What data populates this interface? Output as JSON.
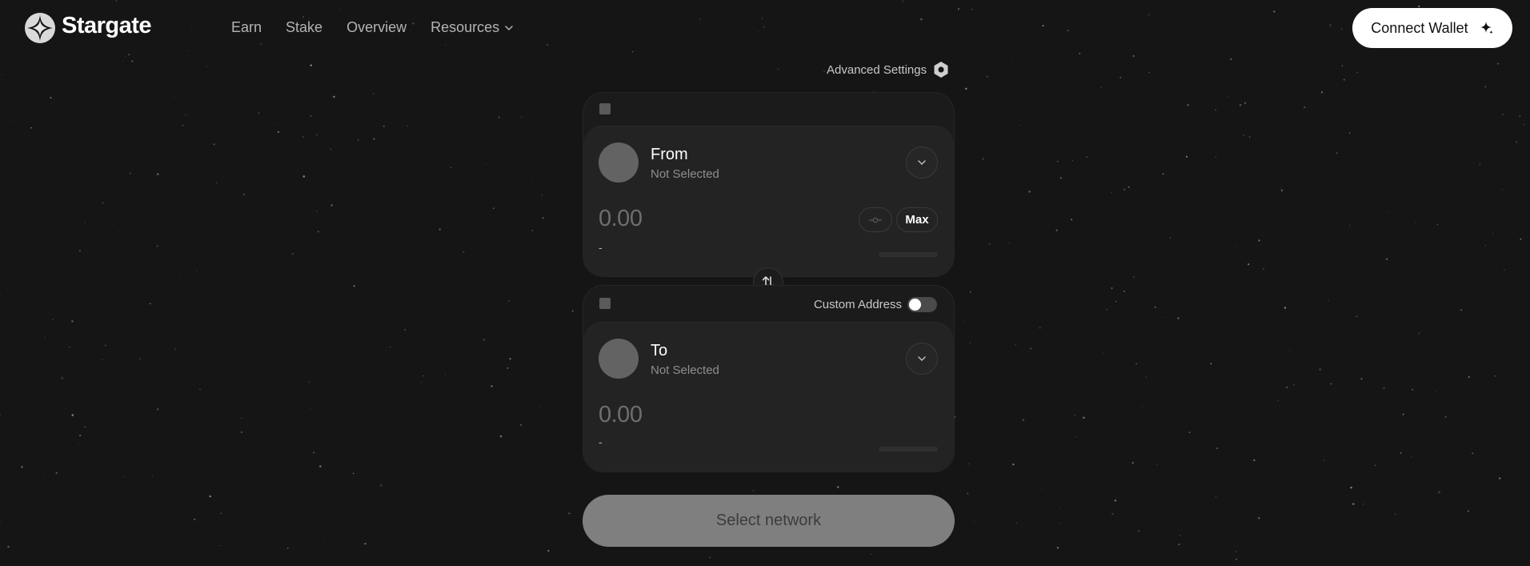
{
  "brand": {
    "name": "Stargate",
    "logo_icon": "stargate-logo-icon"
  },
  "nav": {
    "items": [
      {
        "label": "Earn"
      },
      {
        "label": "Stake"
      },
      {
        "label": "Overview"
      },
      {
        "label": "Resources",
        "icon": "chevron-down-icon"
      }
    ]
  },
  "header": {
    "connect_label": "Connect Wallet",
    "connect_icon": "sparkle-icon"
  },
  "settings": {
    "label": "Advanced Settings",
    "icon": "hexagon-settings-icon"
  },
  "from": {
    "title": "From",
    "subtitle": "Not Selected",
    "amount_placeholder": "0.00",
    "usd_value": "-",
    "max_label": "Max"
  },
  "to": {
    "title": "To",
    "subtitle": "Not Selected",
    "amount_placeholder": "0.00",
    "usd_value": "-",
    "custom_address_label": "Custom Address",
    "custom_address_enabled": false
  },
  "action": {
    "label": "Select network"
  },
  "colors": {
    "background": "#151515",
    "panel": "#1b1b1b",
    "panel_inner": "#232323",
    "button_primary": "#ffffff",
    "button_disabled": "#7f7f7f"
  }
}
